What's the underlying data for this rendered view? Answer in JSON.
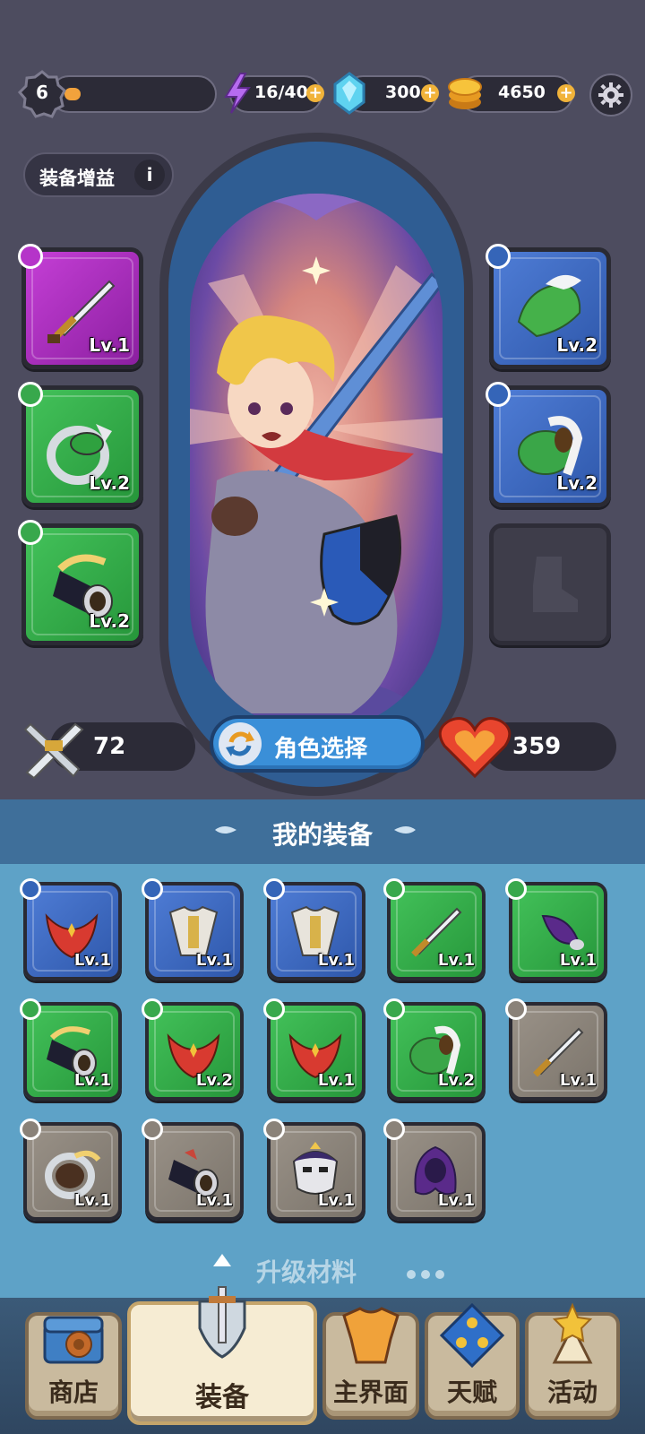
{
  "topbar": {
    "level": "6",
    "xp_progress": 0.12,
    "energy": "16/40",
    "gems": "300",
    "gold": "4650"
  },
  "buff": {
    "label": "装备增益",
    "info": "i"
  },
  "equipped": {
    "left": [
      {
        "level": "Lv.1",
        "rarity": "purple",
        "item": "sword"
      },
      {
        "level": "Lv.2",
        "rarity": "green",
        "item": "ring"
      },
      {
        "level": "Lv.2",
        "rarity": "green",
        "item": "bracer"
      }
    ],
    "right": [
      {
        "level": "Lv.2",
        "rarity": "blue",
        "item": "helmet"
      },
      {
        "level": "Lv.2",
        "rarity": "blue",
        "item": "cloak"
      }
    ]
  },
  "stats": {
    "attack": "72",
    "hp": "359"
  },
  "character_select": "角色选择",
  "my_equipment": {
    "title": "我的装备",
    "items": [
      {
        "level": "Lv.1",
        "rarity": "blue",
        "item": "scarf"
      },
      {
        "level": "Lv.1",
        "rarity": "blue",
        "item": "armor"
      },
      {
        "level": "Lv.1",
        "rarity": "blue",
        "item": "armor"
      },
      {
        "level": "Lv.1",
        "rarity": "green",
        "item": "sword"
      },
      {
        "level": "Lv.1",
        "rarity": "green",
        "item": "feather"
      },
      {
        "level": "Lv.1",
        "rarity": "green",
        "item": "bracer"
      },
      {
        "level": "Lv.2",
        "rarity": "green",
        "item": "scarf"
      },
      {
        "level": "Lv.1",
        "rarity": "green",
        "item": "scarf"
      },
      {
        "level": "Lv.2",
        "rarity": "green",
        "item": "cloak"
      },
      {
        "level": "Lv.1",
        "rarity": "gray",
        "item": "sword"
      },
      {
        "level": "Lv.1",
        "rarity": "gray",
        "item": "ring"
      },
      {
        "level": "Lv.1",
        "rarity": "gray",
        "item": "bracer"
      },
      {
        "level": "Lv.1",
        "rarity": "gray",
        "item": "mask"
      },
      {
        "level": "Lv.1",
        "rarity": "gray",
        "item": "hood"
      }
    ]
  },
  "upgrade_materials": "升级材料",
  "nav": {
    "shop": "商店",
    "equipment": "装备",
    "main": "主界面",
    "talent": "天赋",
    "activity": "活动"
  },
  "colors": {
    "background": "#4d4c5f",
    "accent_gold": "#f1b33a",
    "section_blue": "#3f6f9a",
    "inventory_blue": "#5ea2c7"
  }
}
